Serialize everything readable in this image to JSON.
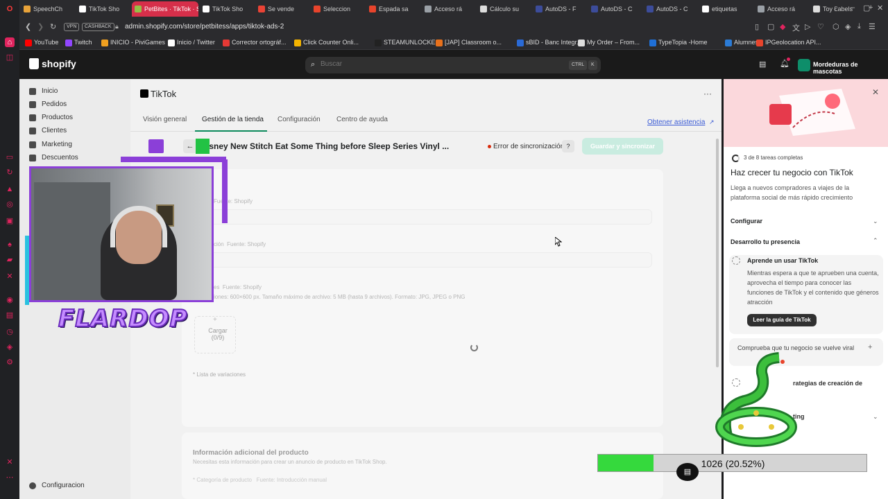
{
  "browser": {
    "tabs": [
      {
        "label": "SpeechCh",
        "color": "#e8a33a"
      },
      {
        "label": "TikTok Sho",
        "color": "#ffffff"
      },
      {
        "label": "PetBites · TikTok · S",
        "color": "#95bf47",
        "active": true
      },
      {
        "label": "TikTok Sho",
        "color": "#ffffff"
      },
      {
        "label": "Se vende",
        "color": "#ea4335"
      },
      {
        "label": "Seleccion",
        "color": "#e8442c"
      },
      {
        "label": "Espada sa",
        "color": "#e8442c"
      },
      {
        "label": "Acceso rá",
        "color": "#9aa0a6"
      },
      {
        "label": "Cálculo su",
        "color": "#dddddd"
      },
      {
        "label": "AutoDS - F",
        "color": "#3c4c9a"
      },
      {
        "label": "AutoDS - C",
        "color": "#3c4c9a"
      },
      {
        "label": "AutoDS - C",
        "color": "#3c4c9a"
      },
      {
        "label": "etiquetas",
        "color": "#ffffff"
      },
      {
        "label": "Acceso rá",
        "color": "#9aa0a6"
      },
      {
        "label": "Toy Labels",
        "color": "#dddddd"
      }
    ],
    "new_tab": "+",
    "address": {
      "vpn": "VPN",
      "cashback": "CASHBACK",
      "url": "admin.shopify.com/store/petbitess/apps/tiktok-ads-2"
    },
    "bookmarks": [
      {
        "label": "YouTube",
        "color": "#ff0000"
      },
      {
        "label": "Twitch",
        "color": "#9146ff"
      },
      {
        "label": "INICIO - PiviGames",
        "color": "#f0a020"
      },
      {
        "label": "Inicio / Twitter",
        "color": "#ffffff"
      },
      {
        "label": "Corrector ortográf...",
        "color": "#e53935"
      },
      {
        "label": "Click Counter Onli...",
        "color": "#f4b400"
      },
      {
        "label": "STEAMUNLOCKE...",
        "color": "#222222"
      },
      {
        "label": "[JAP] Classroom o...",
        "color": "#e8711c"
      },
      {
        "label": "sBID - Banc Integr...",
        "color": "#2a6ad6"
      },
      {
        "label": "My Order – From...",
        "color": "#dddddd"
      },
      {
        "label": "TypeTopia -Home",
        "color": "#1f6fd6"
      },
      {
        "label": "Alumnes",
        "color": "#2b7bd6"
      },
      {
        "label": "IPGeolocation API...",
        "color": "#e8442c"
      }
    ]
  },
  "shopify": {
    "logo": "shopify",
    "search": {
      "placeholder": "Buscar",
      "kbd1": "CTRL",
      "kbd2": "K"
    },
    "store": "Mordeduras de mascotas",
    "nav": [
      "Inicio",
      "Pedidos",
      "Productos",
      "Clientes",
      "Marketing",
      "Descuentos"
    ],
    "nav_settings": "Configuracion"
  },
  "app": {
    "title": "TikTok",
    "more": "···",
    "tabs": [
      "Visión general",
      "Gestión de la tienda",
      "Configuración",
      "Centro de ayuda"
    ],
    "help_link": "Obtener asistencia",
    "product_title": "isney New Stitch Eat Some Thing before Sleep Series Vinyl ...",
    "sync_status": "Error de sincronización",
    "save_button": "Guardar y sincronizar",
    "source1": "Fuente: Shopify",
    "source2_prefix": "ción",
    "source2": "Fuente: Shopify",
    "source3_prefix": "es",
    "source3": "Fuente: Shopify",
    "image_rules": "iones: 600×600 px. Tamaño máximo de archivo: 5 MB (hasta 9 archivos). Formato: JPG, JPEG o PNG",
    "upload_plus": "+",
    "upload_label": "Cargar",
    "upload_count": "(0/9)",
    "variations_label": "* Lista de variaciones",
    "additional_title": "Información adicional del producto",
    "additional_sub": "Necesitas esta información para crear un anuncio de producto en TikTok Shop.",
    "category_label": "* Categoría de producto",
    "category_source": "Fuente: Introducción manual"
  },
  "panel": {
    "progress": "3 de 8 tareas completas",
    "title": "Haz crecer tu negocio con TikTok",
    "subtitle": "Llega a nuevos compradores a viajes de la plataforma social de más rápido crecimiento",
    "section_configure": "Configurar",
    "section_presence": "Desarrollo tu presencia",
    "task_title": "Aprende un usar TikTok",
    "task_desc": "Mientras espera a que te aprueben una cuenta, aprovecha el tiempo para conocer las funciones de TikTok y el contenido que géneros atracción",
    "guide_button": "Leer la guía de TikTok",
    "task2": "Comprueba que tu negocio se vuelve viral",
    "task3": "rategias de creación de",
    "task4": "ting",
    "close": "✕"
  },
  "overlay": {
    "streamer_name": "FLARDOP",
    "counter_text": "1026 (20.52%)",
    "counter_fraction": 0.2052,
    "counter_color": "#35d93d"
  }
}
